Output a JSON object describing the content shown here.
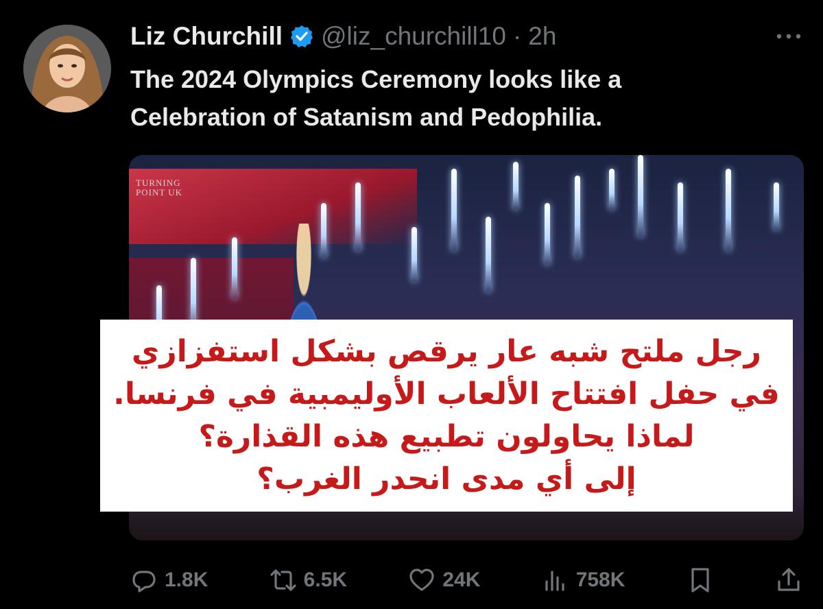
{
  "author": {
    "name": "Liz Churchill",
    "handle": "@liz_churchill10",
    "separator": "·",
    "time": "2h",
    "verified_color": "#1d9bf0"
  },
  "tweet": {
    "text_line1": "The 2024 Olympics Ceremony looks like a",
    "text_line2": "Celebration of Satanism and Pedophilia."
  },
  "media": {
    "watermark_line1": "TURNING",
    "watermark_line2": "POINT UK",
    "overlay_lines": [
      "رجل ملتح شبه عار يرقص بشكل استفزازي",
      "في حفل افتتاح الألعاب الأوليمبية في فرنسا.",
      "لماذا يحاولون تطبيع هذه القذارة؟",
      "إلى أي مدى انحدر الغرب؟"
    ],
    "overlay_text_color": "#c61a1a"
  },
  "actions": {
    "replies": "1.8K",
    "reposts": "6.5K",
    "likes": "24K",
    "views": "758K"
  },
  "icons": {
    "more": "more-icon",
    "reply": "reply-icon",
    "repost": "repost-icon",
    "like": "heart-icon",
    "views": "views-icon",
    "bookmark": "bookmark-icon",
    "share": "share-icon"
  }
}
